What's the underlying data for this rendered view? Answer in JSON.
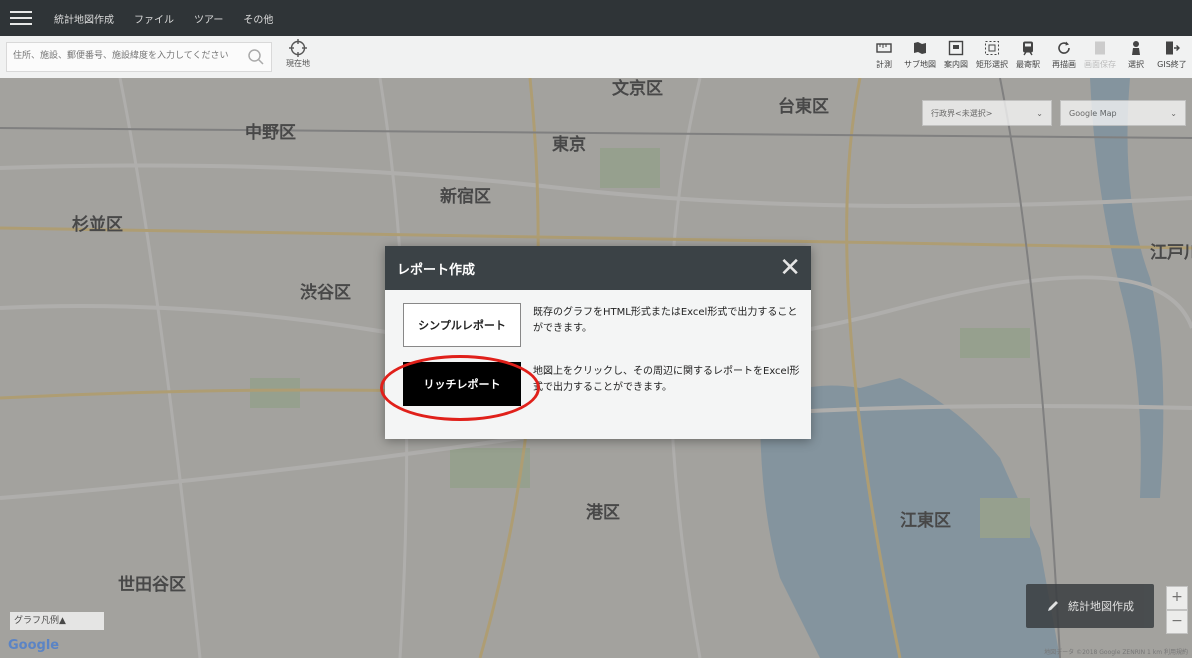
{
  "topbar": {
    "menu": [
      "統計地図作成",
      "ファイル",
      "ツアー",
      "その他"
    ]
  },
  "search": {
    "placeholder": "住所、施設、郵便番号、施設緯度を入力してください",
    "location_label": "現在地"
  },
  "tools": [
    {
      "icon": "ruler-icon",
      "label": "計測"
    },
    {
      "icon": "sub-map-icon",
      "label": "サブ地図"
    },
    {
      "icon": "guide-map-icon",
      "label": "案内図"
    },
    {
      "icon": "rect-select-icon",
      "label": "矩形選択"
    },
    {
      "icon": "train-icon",
      "label": "最寄駅"
    },
    {
      "icon": "redraw-icon",
      "label": "再描画"
    },
    {
      "icon": "disabled-icon",
      "label": "画面保存"
    },
    {
      "icon": "person-select-icon",
      "label": "選択"
    },
    {
      "icon": "exit-icon",
      "label": "GIS終了"
    }
  ],
  "map": {
    "boundary_select": "行政界<未選択>",
    "maptype_select": "Google Map",
    "labels": [
      "文京区",
      "台東区",
      "中野区",
      "東京",
      "新宿区",
      "杉並区",
      "江戸川",
      "港区",
      "江東区",
      "世田谷区",
      "渋谷区"
    ],
    "create_button": "統計地図作成",
    "legend": "グラフ凡例▲",
    "google": "Google",
    "attribution": "地図データ ©2018 Google ZENRIN  1 km  利用規約"
  },
  "dialog": {
    "title": "レポート作成",
    "simple_button": "シンプルレポート",
    "simple_desc": "既存のグラフをHTML形式またはExcel形式で出力することができます。",
    "rich_button": "リッチレポート",
    "rich_desc": "地図上をクリックし、その周辺に関するレポートをExcel形式で出力することができます。"
  },
  "colors": {
    "topbar": "#2f3437",
    "dialog_header": "#3b4246",
    "highlight": "#e0201a"
  }
}
